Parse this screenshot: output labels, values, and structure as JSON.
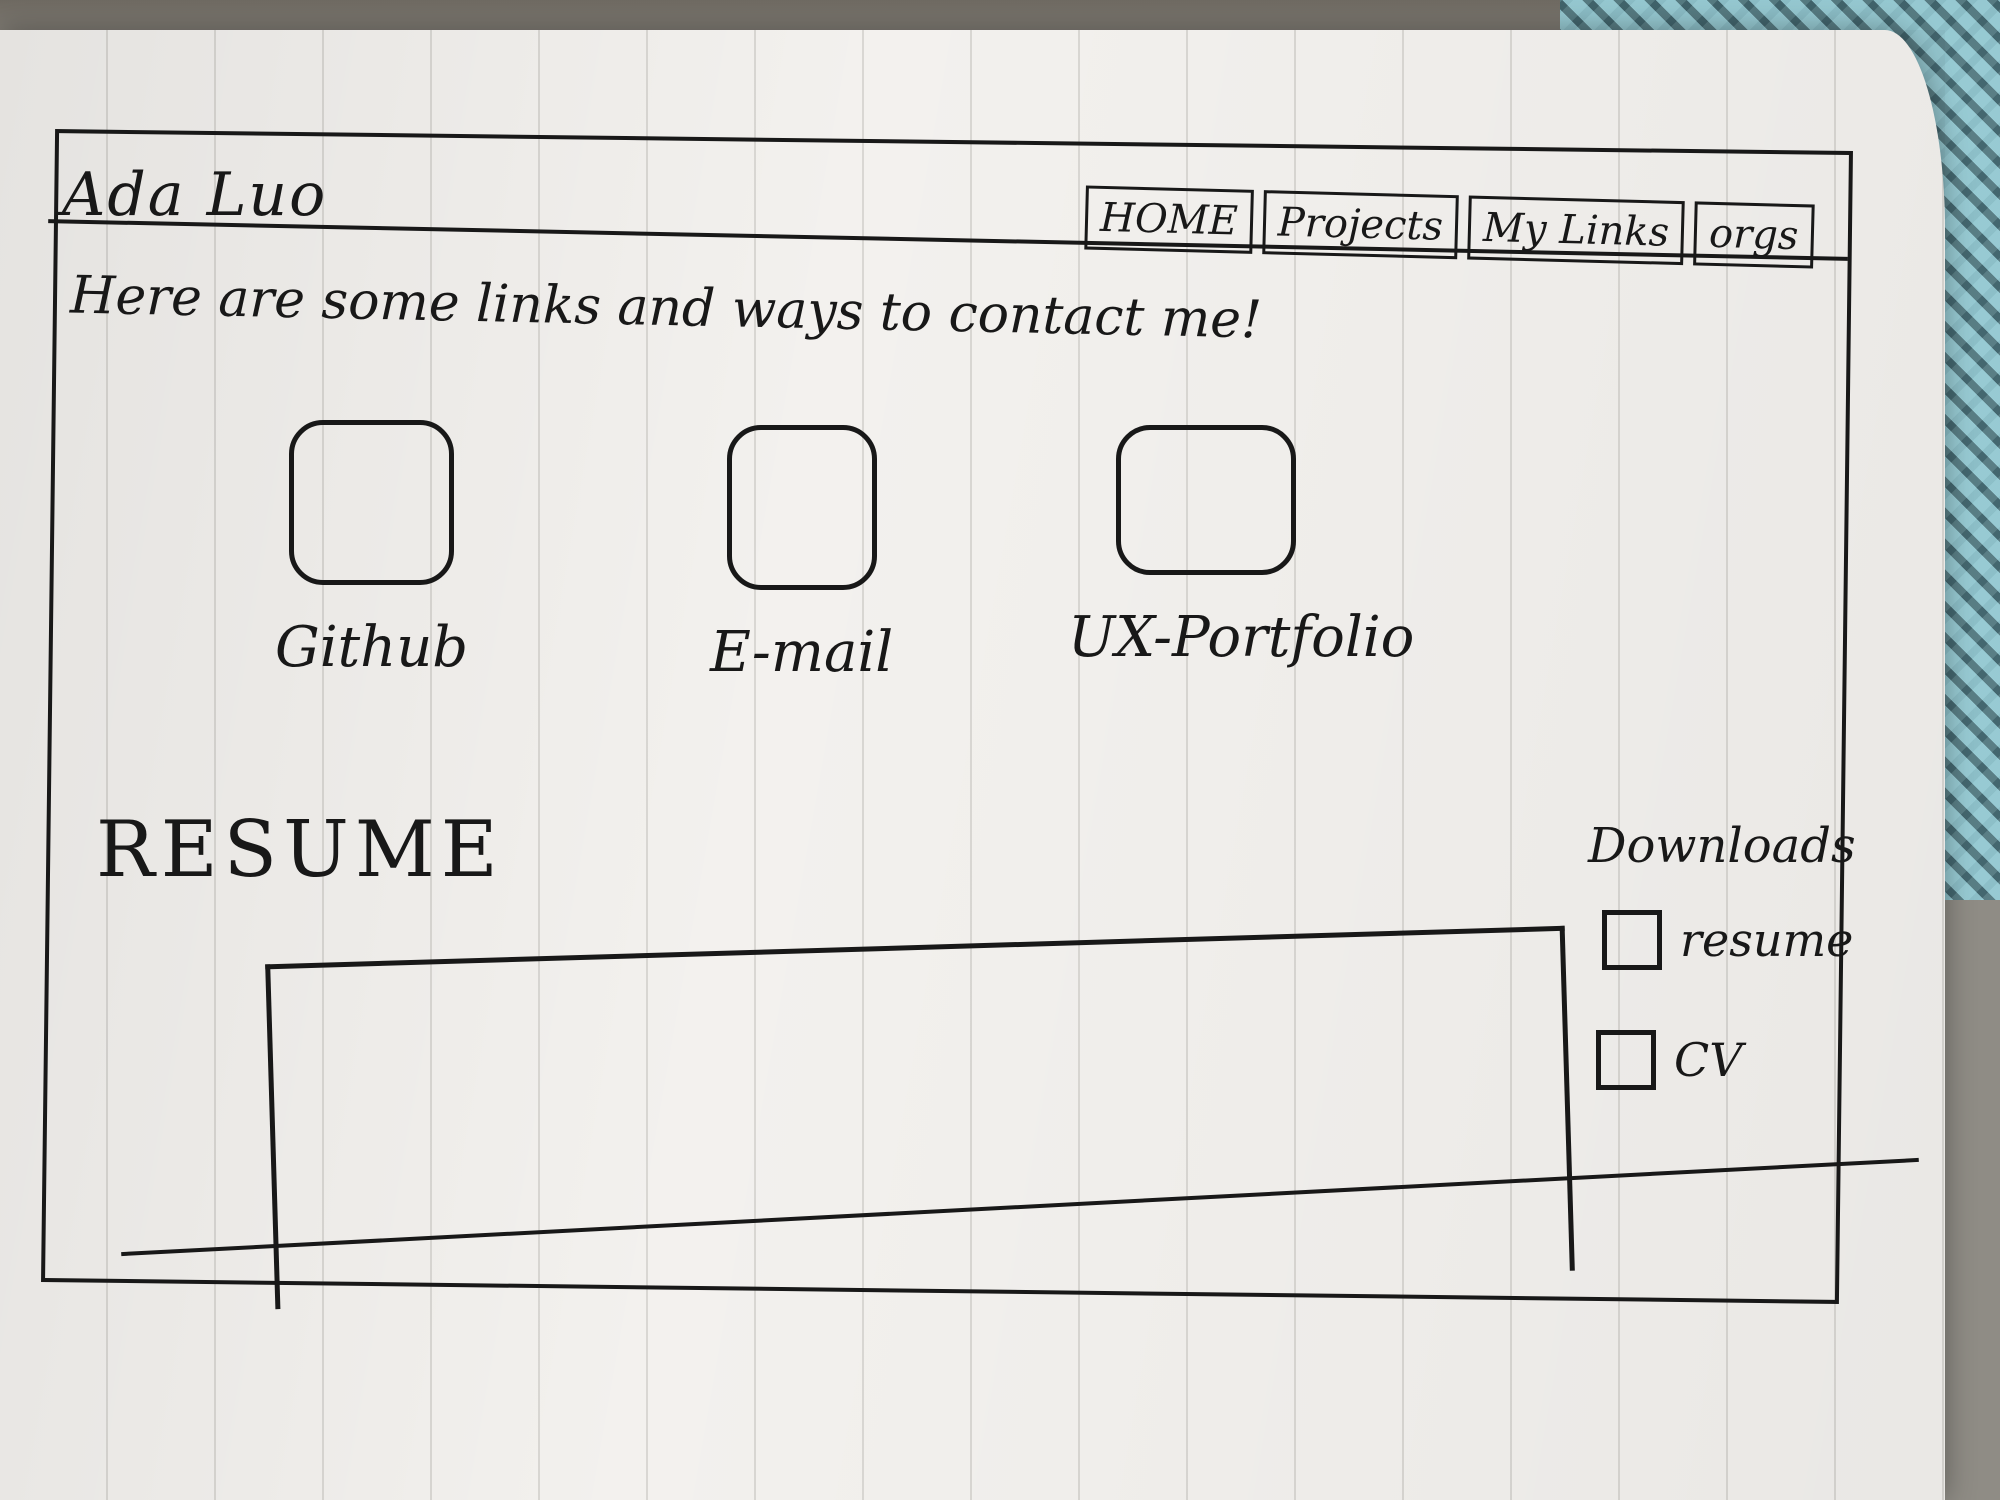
{
  "site": {
    "title": "Ada Luo"
  },
  "nav": {
    "tabs": [
      {
        "label": "HOME"
      },
      {
        "label": "Projects"
      },
      {
        "label": "My Links"
      },
      {
        "label": "orgs"
      }
    ]
  },
  "intro": {
    "text": "Here are some links and ways to contact me!"
  },
  "links": [
    {
      "label": "Github"
    },
    {
      "label": "E-mail"
    },
    {
      "label": "UX-Portfolio"
    }
  ],
  "resume": {
    "heading": "RESUME"
  },
  "downloads": {
    "title": "Downloads",
    "items": [
      {
        "label": "resume"
      },
      {
        "label": "CV"
      }
    ]
  }
}
